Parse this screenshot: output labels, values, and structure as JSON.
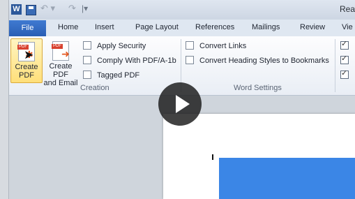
{
  "titlebar": {
    "word_icon_label": "W",
    "undo_glyph": "↶ ▾",
    "redo_glyph": "↷",
    "separator_glyph": "|▾",
    "title": "Rea"
  },
  "tabs": [
    {
      "label": "File"
    },
    {
      "label": "Home"
    },
    {
      "label": "Insert"
    },
    {
      "label": "Page Layout"
    },
    {
      "label": "References"
    },
    {
      "label": "Mailings"
    },
    {
      "label": "Review"
    },
    {
      "label": "Vie"
    }
  ],
  "ribbon": {
    "create_pdf": {
      "line1": "Create",
      "line2": "PDF",
      "icon_band": "PDF"
    },
    "create_pdf_email": {
      "line1": "Create PDF",
      "line2": "and Email",
      "icon_band": "PDF"
    },
    "creation_options": [
      {
        "label": "Apply Security",
        "checked": false
      },
      {
        "label": "Comply With PDF/A-1b",
        "checked": false
      },
      {
        "label": "Tagged PDF",
        "checked": false
      }
    ],
    "creation_group_label": "Creation",
    "word_options": [
      {
        "label": "Convert Links",
        "checked": false
      },
      {
        "label": "Convert Heading Styles to Bookmarks",
        "checked": false
      }
    ],
    "word_group_label": "Word Settings",
    "right_checks": [
      true,
      true,
      true
    ]
  },
  "colors": {
    "file_tab": "#2a5eb4",
    "selected_button": "#ffdf7a",
    "document_blue": "#3b86e6",
    "play_overlay": "#191919"
  },
  "icons": {
    "play": "play-icon",
    "cursor": "mouse-pointer-icon"
  }
}
